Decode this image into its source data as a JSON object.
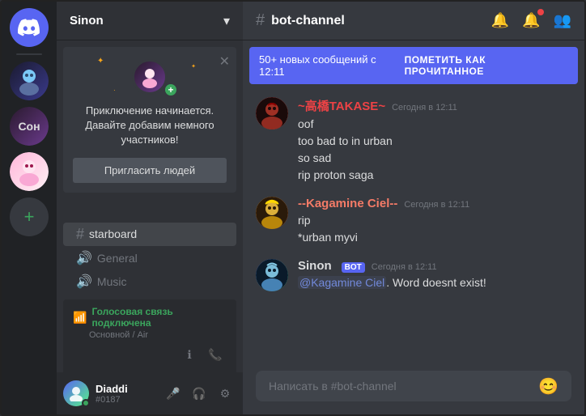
{
  "app": {
    "title": "DISCORD"
  },
  "server": {
    "name": "Sinon",
    "dropdown_label": "▾"
  },
  "welcome_card": {
    "title": "Приключение начинается. Давайте добавим немного участников!",
    "invite_button": "Пригласить людей"
  },
  "channels": {
    "categories": [],
    "items": [
      {
        "type": "text",
        "name": "starboard",
        "active": false
      },
      {
        "type": "voice",
        "name": "General",
        "active": false
      },
      {
        "type": "voice",
        "name": "Music",
        "active": false
      }
    ]
  },
  "voice_status": {
    "connected_text": "Голосовая связь подключена",
    "channel": "Основной / Air"
  },
  "user_panel": {
    "name": "Diaddi",
    "tag": "#0187"
  },
  "chat_header": {
    "channel_name": "bot-channel",
    "hash": "#"
  },
  "unread_banner": {
    "text": "50+ новых сообщений с 12:11",
    "action": "ПОМЕТИТЬ КАК ПРОЧИТАННОЕ"
  },
  "messages": [
    {
      "id": "msg1",
      "username": "~高橋TAKASE~",
      "username_color": "red",
      "timestamp": "Сегодня в 12:11",
      "lines": [
        "oof",
        "too bad to in urban",
        "so sad",
        "rip proton saga"
      ],
      "is_bot": false
    },
    {
      "id": "msg2",
      "username": "--Kagamine Ciel--",
      "username_color": "pink",
      "timestamp": "Сегодня в 12:11",
      "lines": [
        "rip",
        "*urban myvi"
      ],
      "is_bot": false
    },
    {
      "id": "msg3",
      "username": "Sinon",
      "username_color": "white",
      "timestamp": "Сегодня в 12:11",
      "lines": [
        "@Kagamine Ciel. Word doesnt exist!"
      ],
      "is_bot": true,
      "bot_label": "BOT"
    }
  ],
  "chat_input": {
    "placeholder": "Написать в #bot-channel"
  },
  "icons": {
    "bell": "🔔",
    "mention": "🔔",
    "members": "👥",
    "emoji": "😊",
    "mic": "🎤",
    "headphone": "🎧",
    "settings": "⚙",
    "info": "ℹ",
    "phone": "📞",
    "volume": "🔊",
    "hash": "#"
  }
}
